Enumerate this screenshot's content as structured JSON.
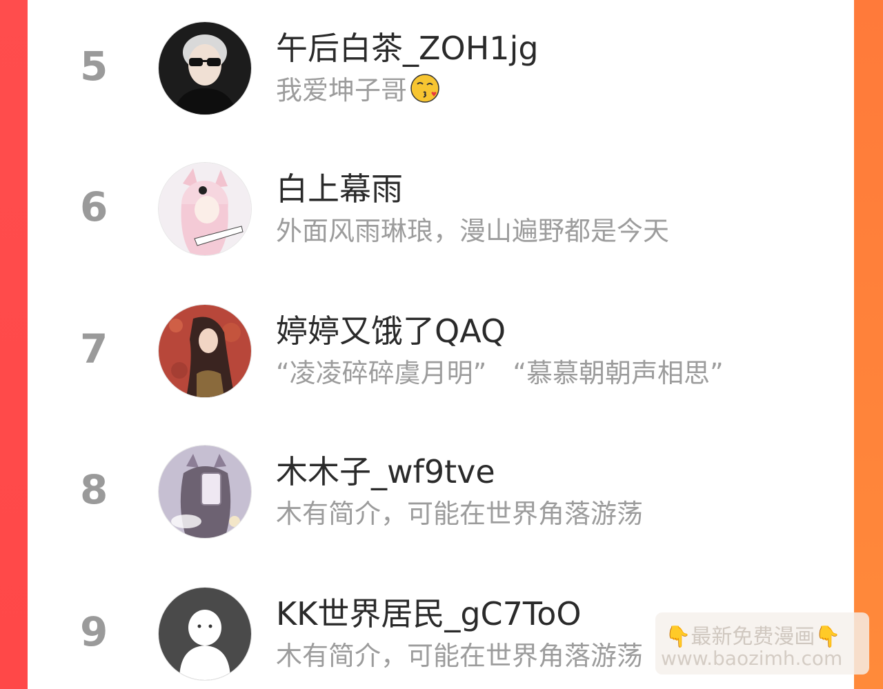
{
  "ranking": {
    "items": [
      {
        "rank": "5",
        "name": "午后白茶_ZOH1jg",
        "bio": "我爱坤子哥",
        "bio_emoji": "kissing-face-emoji",
        "avatar": "man-sunglasses-avatar"
      },
      {
        "rank": "6",
        "name": "白上幕雨",
        "bio": "外面风雨琳琅，漫山遍野都是今天",
        "avatar": "anime-fox-girl-avatar"
      },
      {
        "rank": "7",
        "name": "婷婷又饿了QAQ",
        "bio": "“凌凌碎碎虞月明”　“慕慕朝朝声相思”",
        "avatar": "anime-girl-red-background-avatar"
      },
      {
        "rank": "8",
        "name": "木木子_wf9tve",
        "bio": "木有简介，可能在世界角落游荡",
        "avatar": "cat-ear-girl-phone-avatar"
      },
      {
        "rank": "9",
        "name": "KK世界居民_gC7ToO",
        "bio": "木有简介，可能在世界角落游荡",
        "avatar": "default-ghost-avatar"
      }
    ]
  },
  "watermark": {
    "line1_hand_left": "👇",
    "line1_text": "最新免费漫画",
    "line1_hand_right": "👇",
    "line2": "www.baozimh.com"
  },
  "colors": {
    "edge_left": "#ff4d4d",
    "edge_right": "#ff7a3a",
    "rank": "#9a9a9a",
    "name": "#2a2a2a",
    "bio": "#9c9c9c"
  }
}
